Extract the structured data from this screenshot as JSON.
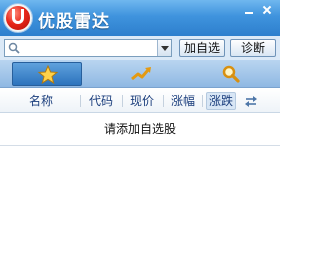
{
  "app": {
    "title": "优股雷达"
  },
  "window_controls": {
    "minimize": "minimize",
    "close": "close"
  },
  "search": {
    "value": "",
    "placeholder": ""
  },
  "buttons": {
    "add_watch": "加自选",
    "diagnose": "诊断"
  },
  "tabs": [
    {
      "icon": "star-icon",
      "selected": true
    },
    {
      "icon": "trend-arrow-icon",
      "selected": false
    },
    {
      "icon": "magnifier-icon",
      "selected": false
    }
  ],
  "columns": {
    "name": "名称",
    "code": "代码",
    "price": "现价",
    "change_pct": "涨幅",
    "change": "涨跌"
  },
  "content": {
    "empty_message": "请添加自选股"
  },
  "colors": {
    "titlebar": "#3f93dd",
    "accent_red": "#e8271a",
    "header_text": "#1a3d7c"
  }
}
